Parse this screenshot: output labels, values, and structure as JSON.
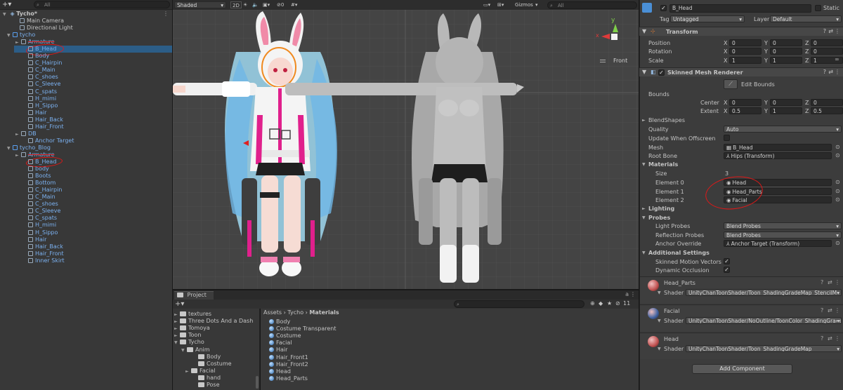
{
  "hierarchy": {
    "search_placeholder": "All",
    "scene_name": "Tycho*",
    "items": [
      {
        "label": "Main Camera"
      },
      {
        "label": "Directional Light"
      },
      {
        "label": "tycho"
      },
      {
        "label": "Armature"
      },
      {
        "label": "B_Head"
      },
      {
        "label": "Body"
      },
      {
        "label": "C_Hairpin"
      },
      {
        "label": "C_Main"
      },
      {
        "label": "C_shoes"
      },
      {
        "label": "C_Sleeve"
      },
      {
        "label": "C_spats"
      },
      {
        "label": "H_mimi"
      },
      {
        "label": "H_Sippo"
      },
      {
        "label": "Hair"
      },
      {
        "label": "Hair_Back"
      },
      {
        "label": "Hair_Front"
      },
      {
        "label": "DB"
      },
      {
        "label": "Anchor Target"
      },
      {
        "label": "tycho_Blog"
      },
      {
        "label": "Armature"
      },
      {
        "label": "B_Head"
      },
      {
        "label": "body"
      },
      {
        "label": "Boots"
      },
      {
        "label": "Bottom"
      },
      {
        "label": "C_Hairpin"
      },
      {
        "label": "C_Main"
      },
      {
        "label": "C_shoes"
      },
      {
        "label": "C_Sleeve"
      },
      {
        "label": "C_spats"
      },
      {
        "label": "H_mimi"
      },
      {
        "label": "H_Sippo"
      },
      {
        "label": "Hair"
      },
      {
        "label": "Hair_Back"
      },
      {
        "label": "Hair_Front"
      },
      {
        "label": "Inner Skirt"
      }
    ]
  },
  "scene": {
    "shading_mode": "Shaded",
    "mode_2d": "2D",
    "gizmos": "Gizmos",
    "search_placeholder": "All",
    "view_label": "Front",
    "gizmo_axis_x": "x",
    "gizmo_axis_y": "y"
  },
  "project": {
    "tab": "Project",
    "search_placeholder": "",
    "badge": "11",
    "breadcrumb": [
      "Assets",
      "Tycho",
      "Materials"
    ],
    "folders": [
      {
        "label": "textures"
      },
      {
        "label": "Three Dots And a Dash"
      },
      {
        "label": "Tomoya"
      },
      {
        "label": "Toon"
      },
      {
        "label": "Tycho"
      },
      {
        "label": "Anim"
      },
      {
        "label": "Body"
      },
      {
        "label": "Costume"
      },
      {
        "label": "Facial"
      },
      {
        "label": "hand"
      },
      {
        "label": "Pose"
      }
    ],
    "materials": [
      "Body",
      "Costume Transparent",
      "Costume",
      "Facial",
      "Hair",
      "Hair_Front1",
      "Hair_Front2",
      "Head",
      "Head_Parts"
    ]
  },
  "inspector": {
    "object_name": "B_Head",
    "static_label": "Static",
    "tag_label": "Tag",
    "tag_value": "Untagged",
    "layer_label": "Layer",
    "layer_value": "Default",
    "transform": {
      "title": "Transform",
      "position_label": "Position",
      "rotation_label": "Rotation",
      "scale_label": "Scale",
      "position": {
        "x": "0",
        "y": "0",
        "z": "0"
      },
      "rotation": {
        "x": "0",
        "y": "0",
        "z": "0"
      },
      "scale": {
        "x": "1",
        "y": "1",
        "z": "1"
      }
    },
    "smr": {
      "title": "Skinned Mesh Renderer",
      "edit_bounds": "Edit Bounds",
      "bounds_label": "Bounds",
      "center_label": "Center",
      "extent_label": "Extent",
      "center": {
        "x": "0",
        "y": "0",
        "z": "0"
      },
      "extent": {
        "x": "0.5",
        "y": "1",
        "z": "0.5"
      },
      "blendshapes": "BlendShapes",
      "quality_label": "Quality",
      "quality_value": "Auto",
      "update_offscreen": "Update When Offscreen",
      "mesh_label": "Mesh",
      "mesh_value": "B_Head",
      "root_bone_label": "Root Bone",
      "root_bone_value": "Hips (Transform)",
      "materials_label": "Materials",
      "size_label": "Size",
      "size_value": "3",
      "elements": [
        {
          "label": "Element 0",
          "value": "Head"
        },
        {
          "label": "Element 1",
          "value": "Head_Parts"
        },
        {
          "label": "Element 2",
          "value": "Facial"
        }
      ],
      "lighting": "Lighting",
      "probes": "Probes",
      "light_probes_label": "Light Probes",
      "light_probes_value": "Blend Probes",
      "reflection_probes_label": "Reflection Probes",
      "reflection_probes_value": "Blend Probes",
      "anchor_override_label": "Anchor Override",
      "anchor_override_value": "Anchor Target (Transform)",
      "additional_settings": "Additional Settings",
      "skinned_motion_label": "Skinned Motion Vectors",
      "dynamic_occlusion_label": "Dynamic Occlusion"
    },
    "material_cards": [
      {
        "name": "Head_Parts",
        "shader_label": "Shader",
        "shader": "UnityChanToonShader/Toon_ShadingGradeMap_StencilMa",
        "color": "#c0504f"
      },
      {
        "name": "Facial",
        "shader_label": "Shader",
        "shader": "UnityChanToonShader/NoOutline/ToonColor_ShadingGrade",
        "color": "#3a5fa0"
      },
      {
        "name": "Head",
        "shader_label": "Shader",
        "shader": "UnityChanToonShader/Toon_ShadingGradeMap",
        "color": "#c0504f"
      }
    ],
    "add_component": "Add Component"
  }
}
